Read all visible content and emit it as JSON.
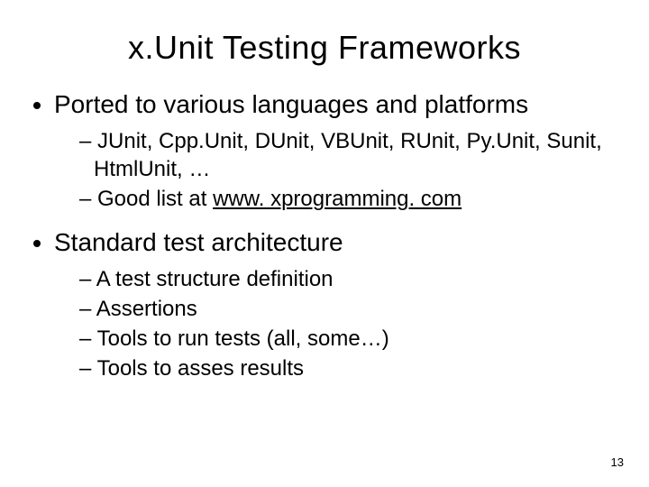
{
  "title": "x.Unit Testing Frameworks",
  "bullets": {
    "b1": {
      "text": "Ported to various languages and platforms",
      "sub": {
        "s1a": "JUnit, Cpp.Unit, DUnit, VBUnit, RUnit, Py.Unit, Sunit, HtmlUnit, …",
        "s1b_prefix": "Good list at ",
        "s1b_link": "www. xprogramming. com"
      }
    },
    "b2": {
      "text": "Standard test architecture",
      "sub": {
        "s2a": "A test structure definition",
        "s2b": "Assertions",
        "s2c": "Tools to run tests (all, some…)",
        "s2d": "Tools to asses results"
      }
    }
  },
  "page_number": "13"
}
